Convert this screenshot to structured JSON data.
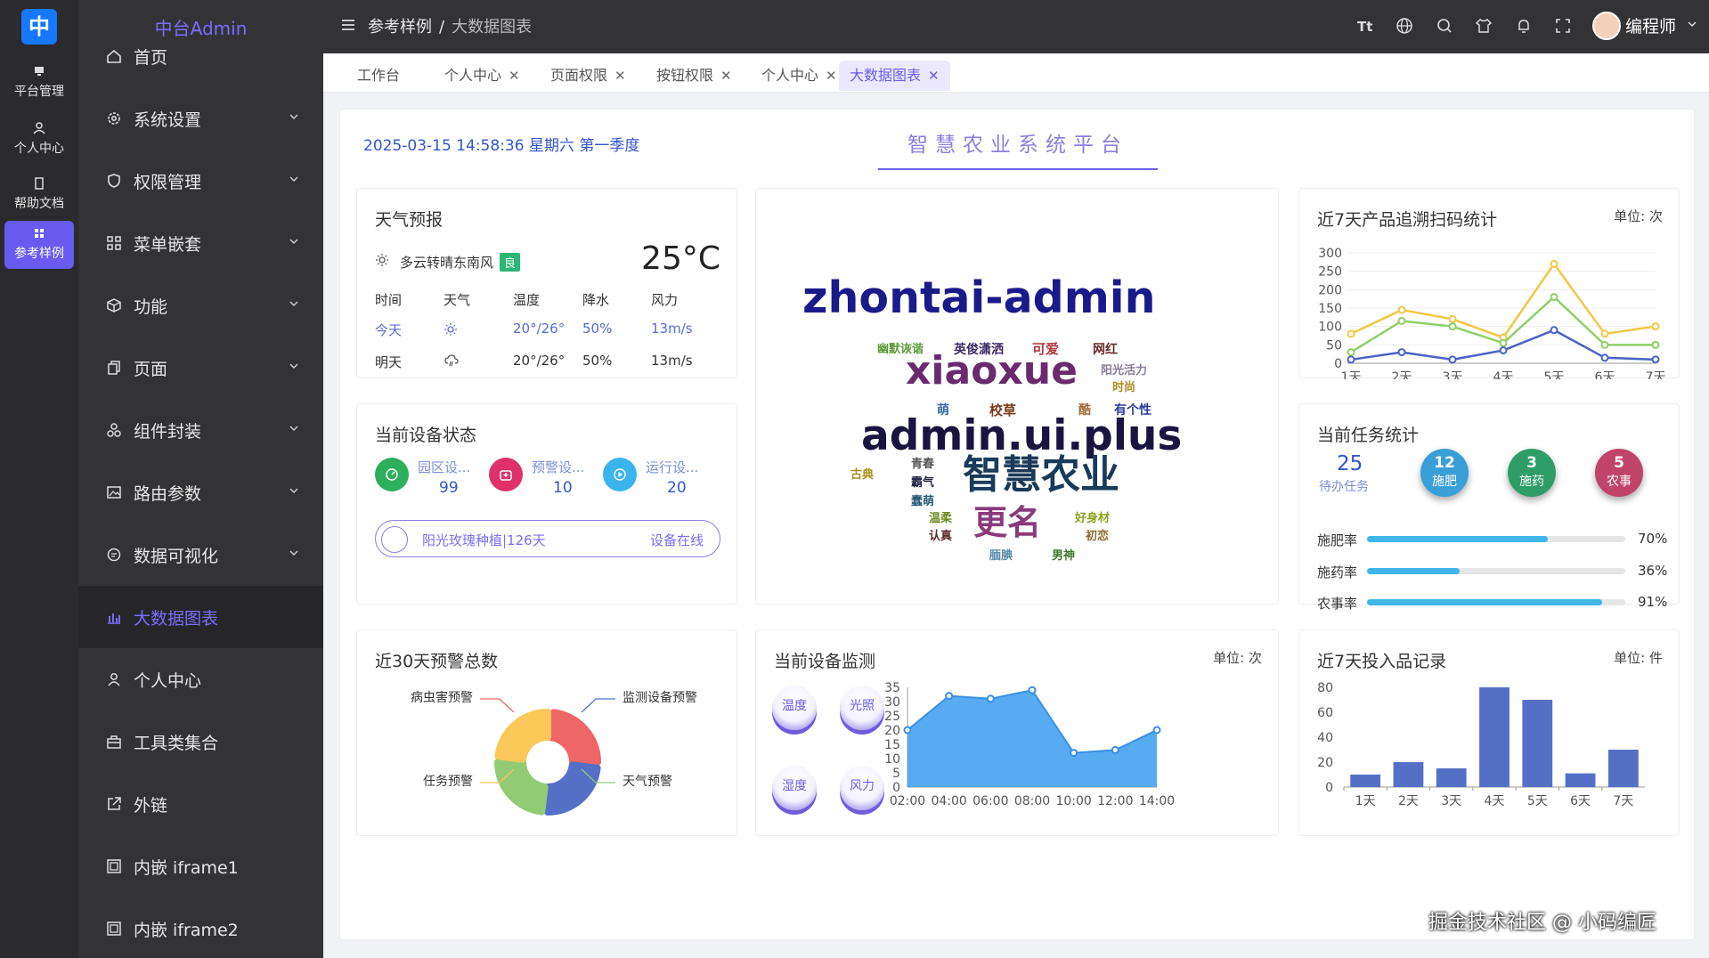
{
  "rail": {
    "logo": "中",
    "items": [
      {
        "label": "平台管理",
        "icon": "monitor-icon"
      },
      {
        "label": "个人中心",
        "icon": "user-icon"
      },
      {
        "label": "帮助文档",
        "icon": "document-icon"
      },
      {
        "label": "参考样例",
        "icon": "grid-icon",
        "active": true
      }
    ]
  },
  "sidebar": {
    "brand": "中台Admin",
    "items": [
      {
        "label": "首页",
        "icon": "home-icon"
      },
      {
        "label": "系统设置",
        "icon": "gear-icon",
        "expandable": true
      },
      {
        "label": "权限管理",
        "icon": "shield-icon",
        "expandable": true
      },
      {
        "label": "菜单嵌套",
        "icon": "grid-icon",
        "expandable": true
      },
      {
        "label": "功能",
        "icon": "cube-icon",
        "expandable": true
      },
      {
        "label": "页面",
        "icon": "copy-icon",
        "expandable": true
      },
      {
        "label": "组件封装",
        "icon": "components-icon",
        "expandable": true
      },
      {
        "label": "路由参数",
        "icon": "picture-icon",
        "expandable": true
      },
      {
        "label": "数据可视化",
        "icon": "chat-icon",
        "expandable": true
      },
      {
        "label": "大数据图表",
        "icon": "bar-chart-icon",
        "active": true
      },
      {
        "label": "个人中心",
        "icon": "user-icon"
      },
      {
        "label": "工具类集合",
        "icon": "toolbox-icon"
      },
      {
        "label": "外链",
        "icon": "external-link-icon"
      },
      {
        "label": "内嵌 iframe1",
        "icon": "frame-icon"
      },
      {
        "label": "内嵌 iframe2",
        "icon": "frame-icon"
      }
    ]
  },
  "header": {
    "breadcrumb": [
      "参考样例",
      "大数据图表"
    ],
    "separator": "/",
    "icons": [
      "font-size-icon",
      "globe-icon",
      "search-icon",
      "shirt-icon",
      "bell-icon",
      "fullscreen-icon"
    ],
    "user": "编程师"
  },
  "tabs": [
    {
      "label": "工作台",
      "closable": false
    },
    {
      "label": "个人中心",
      "closable": true
    },
    {
      "label": "页面权限",
      "closable": true
    },
    {
      "label": "按钮权限",
      "closable": true
    },
    {
      "label": "个人中心",
      "closable": true
    },
    {
      "label": "大数据图表",
      "closable": true,
      "active": true
    }
  ],
  "dashboard": {
    "datetime": "2025-03-15 14:58:36 星期六 第一季度",
    "title": "智慧农业系统平台"
  },
  "weather": {
    "title": "天气预报",
    "summary": "多云转晴东南风",
    "quality": "良",
    "temperature": "25°C",
    "headers": [
      "时间",
      "天气",
      "温度",
      "降水",
      "风力"
    ],
    "rows": [
      {
        "day": "今天",
        "icon": "sun-icon",
        "temp": "20°/26°",
        "rain": "50%",
        "wind": "13m/s",
        "highlight": true
      },
      {
        "day": "明天",
        "icon": "cloud-rain-icon",
        "temp": "20°/26°",
        "rain": "50%",
        "wind": "13m/s",
        "highlight": false
      }
    ]
  },
  "device_status": {
    "title": "当前设备状态",
    "items": [
      {
        "name": "园区设...",
        "count": "99",
        "color": "#2eaf5e",
        "icon": "gauge-icon"
      },
      {
        "name": "预警设...",
        "count": "10",
        "color": "#e0306a",
        "icon": "alarm-icon"
      },
      {
        "name": "运行设...",
        "count": "20",
        "color": "#3ab4ee",
        "icon": "play-icon"
      }
    ],
    "pill_text": "阳光玫瑰种植|126天",
    "pill_status": "设备在线"
  },
  "wordcloud": {
    "words": [
      {
        "text": "zhontai-admin",
        "color": "#1b1a8a"
      },
      {
        "text": "幽默诙谐",
        "color": "#5c9a3a"
      },
      {
        "text": "英俊潇洒",
        "color": "#3d2a66"
      },
      {
        "text": "可爱",
        "color": "#b03a3a"
      },
      {
        "text": "网红",
        "color": "#6a2a2a"
      },
      {
        "text": "xiaoxue",
        "color": "#6b2a6e"
      },
      {
        "text": "阳光活力",
        "color": "#8a7a9a"
      },
      {
        "text": "时尚",
        "color": "#b08a1a"
      },
      {
        "text": "萌",
        "color": "#3a6aa8"
      },
      {
        "text": "校草",
        "color": "#7a3a1a"
      },
      {
        "text": "酷",
        "color": "#a06a3a"
      },
      {
        "text": "有个性",
        "color": "#2a3a9a"
      },
      {
        "text": "admin.ui.plus",
        "color": "#1a1440"
      },
      {
        "text": "古典",
        "color": "#a8901a"
      },
      {
        "text": "青春",
        "color": "#555555"
      },
      {
        "text": "霸气",
        "color": "#222244"
      },
      {
        "text": "蠢萌",
        "color": "#2a5a7a"
      },
      {
        "text": "智慧农业",
        "color": "#1a3a5a"
      },
      {
        "text": "温柔",
        "color": "#6a8a1a"
      },
      {
        "text": "认真",
        "color": "#5a2a2a"
      },
      {
        "text": "更名",
        "color": "#8a3a7a"
      },
      {
        "text": "好身材",
        "color": "#8aa01a"
      },
      {
        "text": "初恋",
        "color": "#8a6a2a"
      },
      {
        "text": "腼腆",
        "color": "#5a8aa8"
      },
      {
        "text": "男神",
        "color": "#3a7a2a"
      }
    ]
  },
  "trace_chart": {
    "title": "近7天产品追溯扫码统计",
    "unit": "单位: 次"
  },
  "task_stats": {
    "title": "当前任务统计",
    "pending_value": "25",
    "pending_label": "待办任务",
    "balls": [
      {
        "value": "12",
        "label": "施肥",
        "color": "#3a9fd8"
      },
      {
        "value": "3",
        "label": "施药",
        "color": "#2e9d68"
      },
      {
        "value": "5",
        "label": "农事",
        "color": "#c0436a"
      }
    ],
    "rates": [
      {
        "label": "施肥率",
        "value": 0.7,
        "text": "70%"
      },
      {
        "label": "施药率",
        "value": 0.36,
        "text": "36%"
      },
      {
        "label": "农事率",
        "value": 0.91,
        "text": "91%"
      }
    ]
  },
  "alert_chart": {
    "title": "近30天预警总数",
    "labels": [
      "病虫害预警",
      "监测设备预警",
      "任务预警",
      "天气预警"
    ]
  },
  "monitor": {
    "title": "当前设备监测",
    "unit": "单位: 次",
    "balls": [
      "温度",
      "光照",
      "湿度",
      "风力"
    ]
  },
  "input_chart": {
    "title": "近7天投入品记录",
    "unit": "单位: 件"
  },
  "watermark": "掘金技术社区 @ 小码编匠",
  "chart_data": [
    {
      "type": "line",
      "title": "近7天产品追溯扫码统计",
      "categories": [
        "1天",
        "2天",
        "3天",
        "4天",
        "5天",
        "6天",
        "7天"
      ],
      "ylim": [
        0,
        300
      ],
      "yticks": [
        0,
        50,
        100,
        150,
        200,
        250,
        300
      ],
      "grid": true,
      "series": [
        {
          "values": [
            80,
            145,
            120,
            70,
            270,
            80,
            100
          ],
          "color": "#f2c744"
        },
        {
          "values": [
            30,
            115,
            100,
            55,
            180,
            50,
            50
          ],
          "color": "#8fcf6a"
        },
        {
          "values": [
            10,
            30,
            10,
            35,
            90,
            15,
            10
          ],
          "color": "#4a62c4"
        }
      ]
    },
    {
      "type": "pie",
      "title": "近30天预警总数",
      "slices": [
        {
          "name": "病虫害预警",
          "value": 25,
          "color": "#ee6666"
        },
        {
          "name": "监测设备预警",
          "value": 25,
          "color": "#5470c6"
        },
        {
          "name": "天气预警",
          "value": 25,
          "color": "#91cc75"
        },
        {
          "name": "任务预警",
          "value": 25,
          "color": "#fac858"
        }
      ]
    },
    {
      "type": "area",
      "title": "当前设备监测",
      "categories": [
        "02:00",
        "04:00",
        "06:00",
        "08:00",
        "10:00",
        "12:00",
        "14:00"
      ],
      "values": [
        20,
        32,
        31,
        34,
        12,
        13,
        20
      ],
      "ylim": [
        0,
        35
      ],
      "yticks": [
        0,
        5,
        10,
        15,
        20,
        25,
        30,
        35
      ],
      "color": "#4da6f0"
    },
    {
      "type": "bar",
      "title": "近7天投入品记录",
      "categories": [
        "1天",
        "2天",
        "3天",
        "4天",
        "5天",
        "6天",
        "7天"
      ],
      "values": [
        10,
        20,
        15,
        80,
        70,
        11,
        30
      ],
      "ylim": [
        0,
        80
      ],
      "yticks": [
        0,
        20,
        40,
        60,
        80
      ],
      "color": "#5470c6"
    }
  ]
}
